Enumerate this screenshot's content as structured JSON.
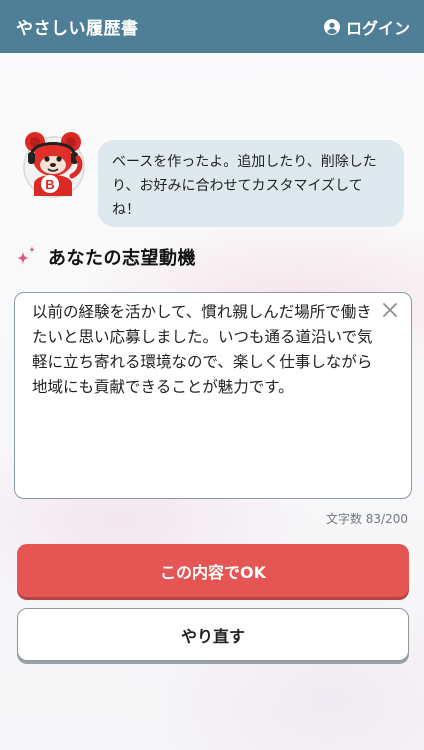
{
  "header": {
    "app_title": "やさしい履歴書",
    "login_label": "ログイン"
  },
  "assistant": {
    "message": "ベースを作ったよ。追加したり、削除したり、お好みに合わせてカスタマイズしてね！",
    "mascot_letter": "B"
  },
  "section": {
    "title": "あなたの志望動機"
  },
  "editor": {
    "text": "以前の経験を活かして、慣れ親しんだ場所で働きたいと思い応募しました。いつも通る道沿いで気軽に立ち寄れる環境なので、楽しく仕事しながら地域にも貢献できることが魅力です。",
    "char_count": "文字数 83/200"
  },
  "actions": {
    "ok_label": "この内容でOK",
    "retry_label": "やり直す"
  },
  "colors": {
    "header": "#4f7f97",
    "primary": "#e45553",
    "bubble": "#dde9ee"
  }
}
